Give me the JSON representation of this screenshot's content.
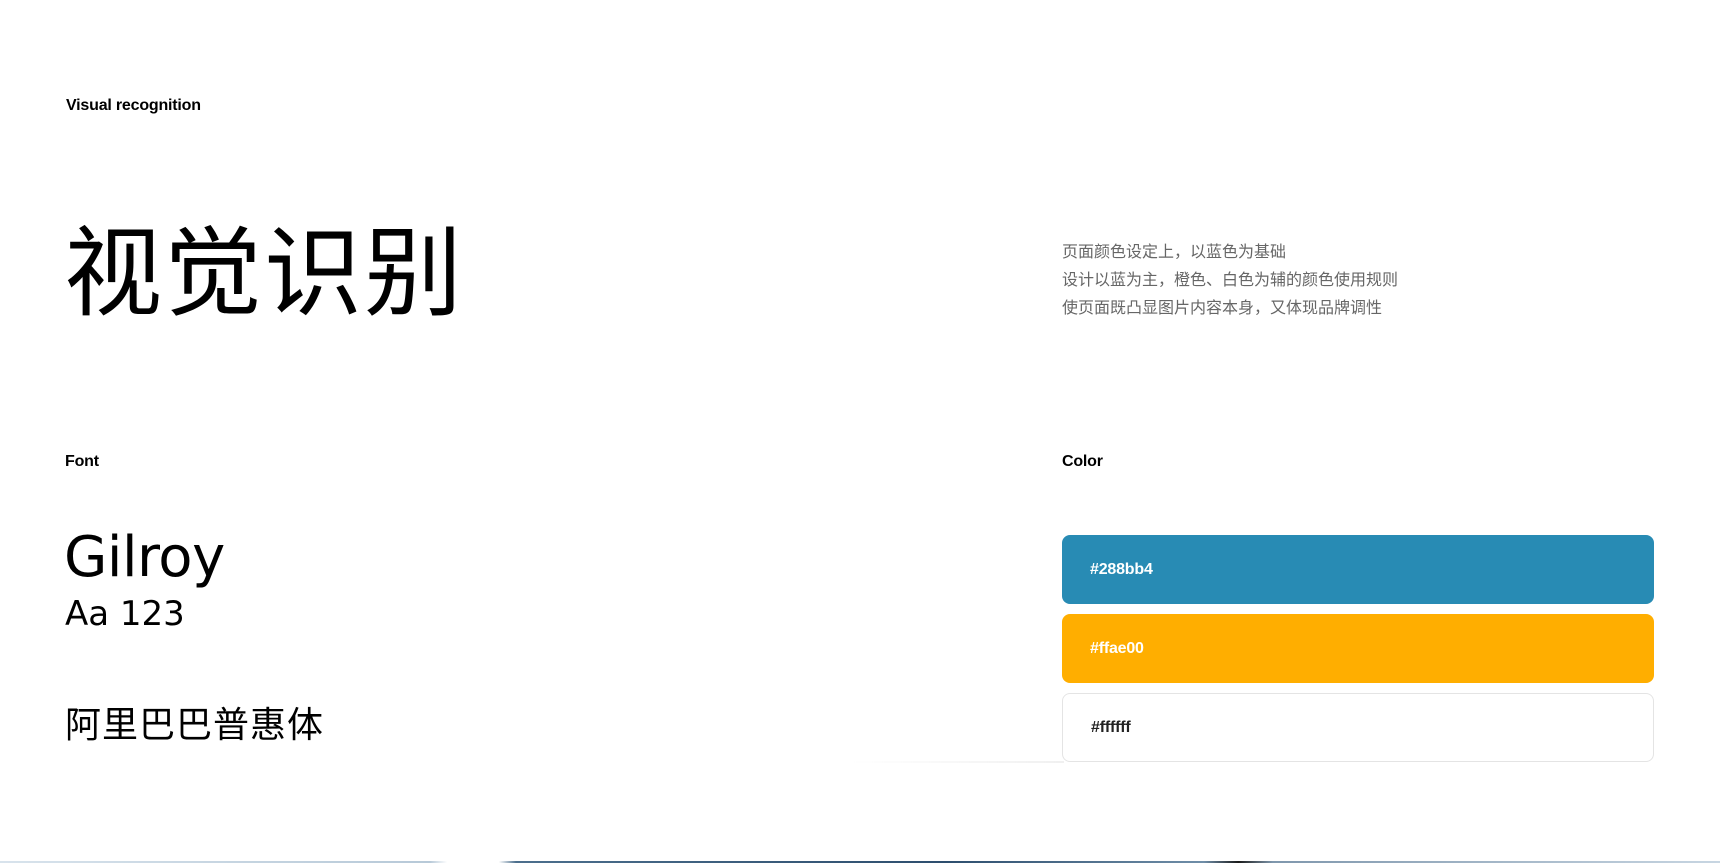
{
  "header": {
    "section_label": "Visual recognition",
    "title": "视觉识别"
  },
  "description": {
    "lines": [
      "页面颜色设定上，以蓝色为基础",
      "设计以蓝为主，橙色、白色为辅的颜色使用规则",
      "使页面既凸显图片内容本身，又体现品牌调性"
    ]
  },
  "font_section": {
    "label": "Font",
    "latin_font_name": "Gilroy",
    "latin_sample": "Aa 123",
    "cn_font_name": "阿里巴巴普惠体"
  },
  "color_section": {
    "label": "Color",
    "swatches": [
      {
        "label": "#288bb4",
        "color": "#288bb4"
      },
      {
        "label": "#ffae00",
        "color": "#ffae00"
      },
      {
        "label": "#ffffff",
        "color": "#ffffff"
      }
    ]
  }
}
